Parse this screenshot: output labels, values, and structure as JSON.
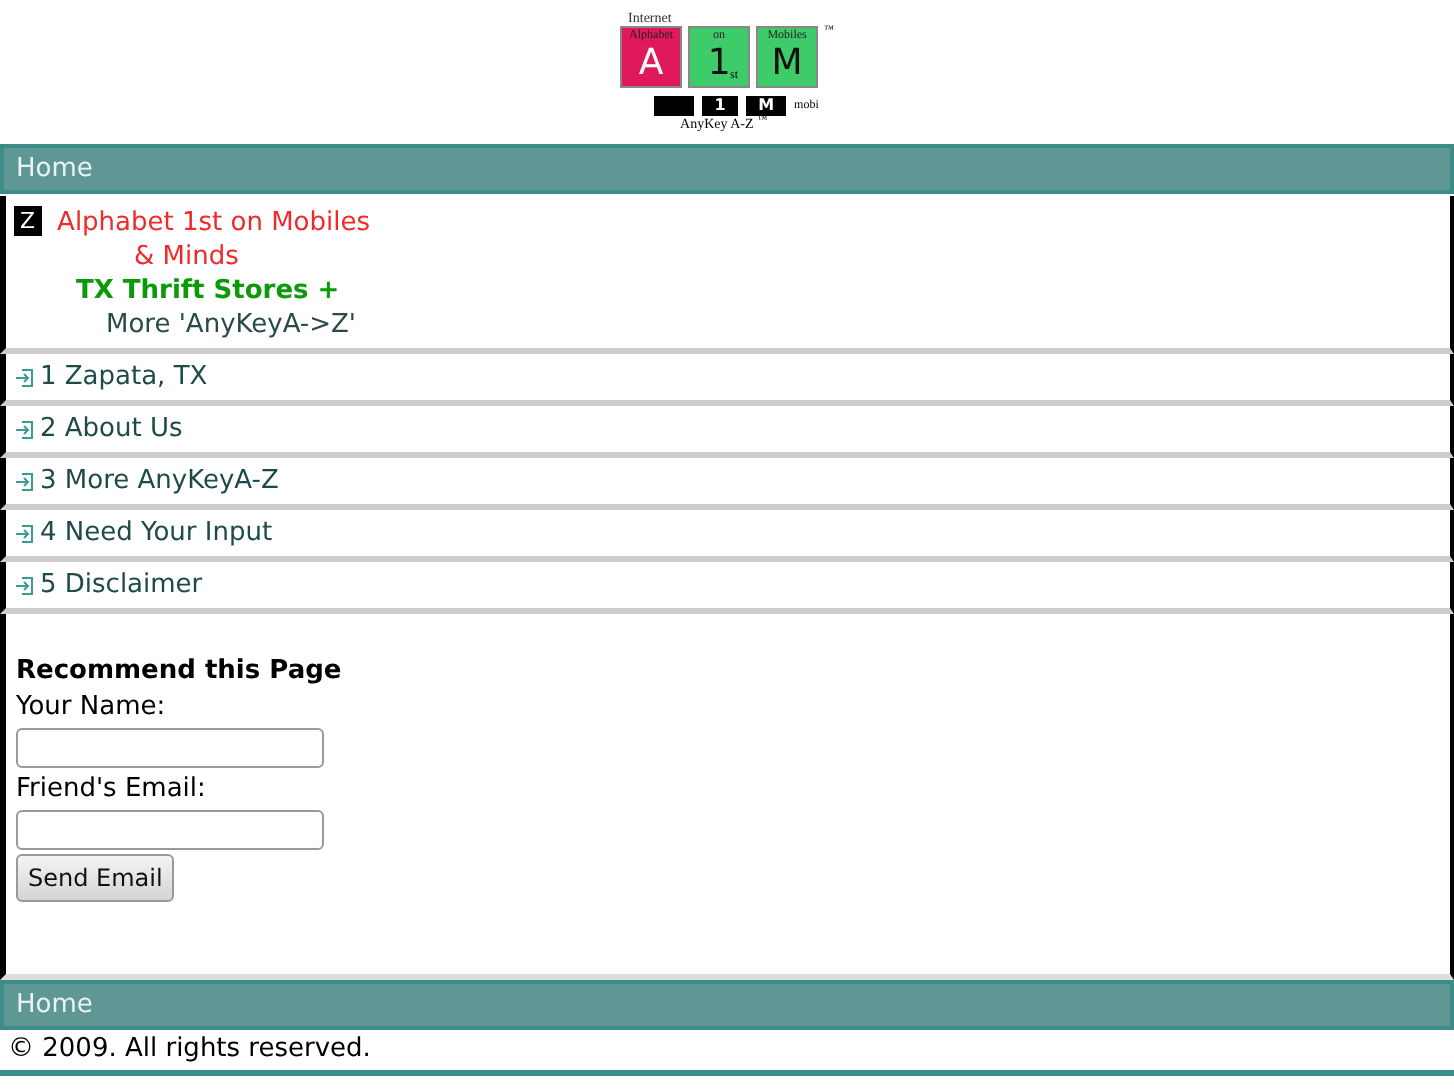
{
  "logo": {
    "top_label": "Internet",
    "tiles": [
      {
        "small": "Alphabet",
        "big": "A",
        "color": "#e0195a"
      },
      {
        "small": "on",
        "big": "1",
        "sub": "st",
        "color": "#3ecb6a"
      },
      {
        "small": "Mobiles",
        "big": "M",
        "color": "#3ecb6a"
      }
    ],
    "tm": "™",
    "keys": [
      "1",
      "M"
    ],
    "mobi": "mobi",
    "tagline": "AnyKey A-Z",
    "tagline_tm": "™"
  },
  "nav_top": {
    "label": "Home"
  },
  "intro": {
    "badge": "Z",
    "lines": [
      {
        "text": "Alphabet 1st on Mobiles",
        "color": "#f02a2a",
        "kind": "text"
      },
      {
        "text": "& Minds",
        "color": "#f02a2a",
        "kind": "text"
      },
      {
        "text": "TX Thrift Stores +",
        "color": "#0a9a0a",
        "kind": "highlight"
      },
      {
        "text": "More 'AnyKeyA->Z'",
        "color": "#2a4a4a",
        "kind": "text"
      }
    ]
  },
  "menu": [
    {
      "label": "1 Zapata, TX"
    },
    {
      "label": "2 About Us"
    },
    {
      "label": "3 More AnyKeyA-Z"
    },
    {
      "label": "4 Need Your Input"
    },
    {
      "label": "5 Disclaimer"
    }
  ],
  "form": {
    "title": "Recommend this Page",
    "fields": [
      {
        "label": "Your Name:"
      },
      {
        "label": "Friend's Email:"
      }
    ],
    "button": "Send Email"
  },
  "nav_bottom": {
    "label": "Home"
  },
  "footer": {
    "copyright": "© 2009. All rights reserved."
  }
}
